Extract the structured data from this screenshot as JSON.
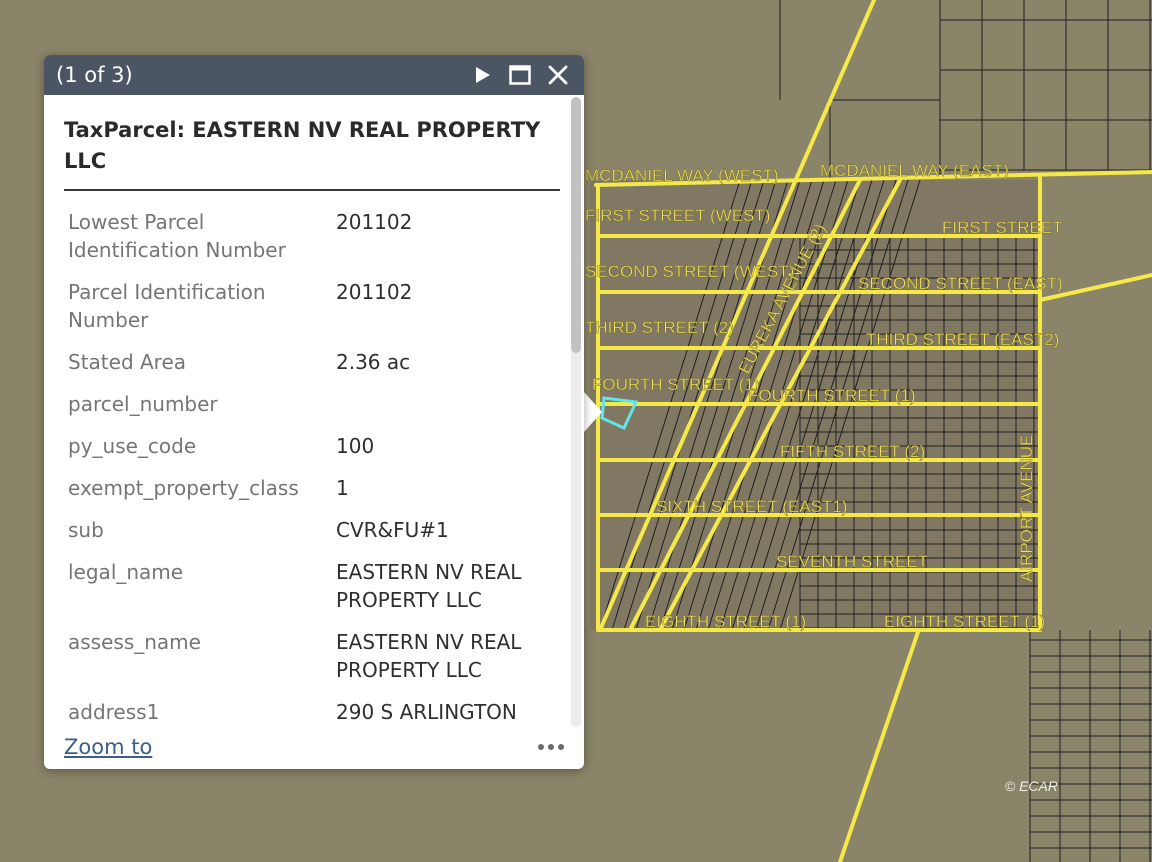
{
  "map": {
    "colors": {
      "background": "#8a8468",
      "roads": "#f5e94a",
      "parcels": "#1f1f1f",
      "selected": "#5fe6e6"
    },
    "street_labels": [
      "MCDANIEL WAY (WEST)",
      "MCDANIEL WAY (EAST)",
      "FIRST STREET (WEST)",
      "FIRST STREET",
      "SECOND STREET (WEST)",
      "SECOND STREET (EAST)",
      "THIRD STREET (2)",
      "THIRD STREET (EAST2)",
      "FOURTH STREET (1)",
      "FOURTH STREET (1)",
      "FIFTH STREET (2)",
      "SIXTH STREET (EAST1)",
      "SEVENTH STREET",
      "EIGHTH STREET (1)",
      "EIGHTH STREET (1)",
      "EUREKA AVENUE (2)",
      "AIRPORT AVENUE"
    ],
    "copyright": "© ECAR"
  },
  "popup": {
    "feature_count": "(1 of 3)",
    "title": "TaxParcel: EASTERN NV REAL PROPERTY LLC",
    "icons": {
      "next": "play-icon",
      "maximize": "maximize-icon",
      "close": "close-icon",
      "more": "more-icon"
    },
    "attributes": [
      {
        "key": "Lowest Parcel Identification Number",
        "value": "201102"
      },
      {
        "key": "Parcel Identification Number",
        "value": "201102"
      },
      {
        "key": "Stated Area",
        "value": "2.36 ac"
      },
      {
        "key": "parcel_number",
        "value": ""
      },
      {
        "key": "py_use_code",
        "value": "100"
      },
      {
        "key": "exempt_property_class",
        "value": "1"
      },
      {
        "key": "sub",
        "value": "CVR&FU#1"
      },
      {
        "key": "legal_name",
        "value": "EASTERN NV REAL PROPERTY LLC"
      },
      {
        "key": "assess_name",
        "value": "EASTERN NV REAL PROPERTY LLC"
      },
      {
        "key": "address1",
        "value": "290 S ARLINGTON"
      }
    ],
    "zoom_label": "Zoom to"
  }
}
